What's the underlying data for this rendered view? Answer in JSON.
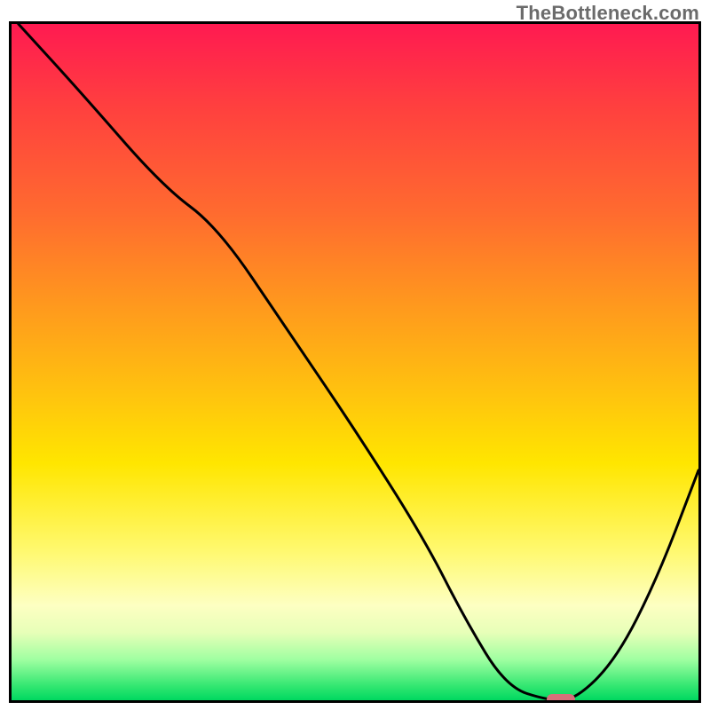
{
  "watermark": "TheBottleneck.com",
  "chart_data": {
    "type": "line",
    "title": "",
    "xlabel": "",
    "ylabel": "",
    "xlim": [
      0,
      100
    ],
    "ylim": [
      0,
      100
    ],
    "grid": false,
    "legend": false,
    "series": [
      {
        "name": "curve",
        "color": "#000000",
        "x": [
          1,
          10,
          22,
          30,
          40,
          50,
          60,
          66,
          72,
          78,
          82,
          88,
          94,
          100
        ],
        "y": [
          100,
          90,
          76,
          70,
          55,
          40,
          24,
          12,
          2,
          0,
          0,
          6,
          18,
          34
        ]
      }
    ],
    "marker": {
      "x": 80,
      "y": 0,
      "color": "#d6707a"
    },
    "background_gradient": {
      "top": "#ff1a51",
      "mid": "#ffe600",
      "bottom": "#00d860"
    }
  }
}
